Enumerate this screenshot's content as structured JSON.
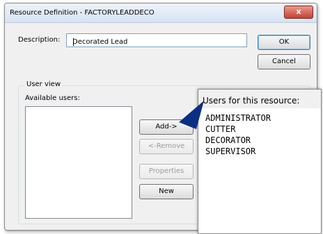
{
  "window": {
    "title": "Resource Definition - FACTORYLEADDECO",
    "close_glyph": "x"
  },
  "description": {
    "label": "Description:",
    "value": "Decorated Lead"
  },
  "buttons": {
    "ok": "OK",
    "cancel": "Cancel",
    "add": "Add->",
    "remove": "<-Remove",
    "properties": "Properties",
    "new": "New"
  },
  "user_view": {
    "group_label": "User view",
    "available_label": "Available users:",
    "available_users": []
  },
  "resource_users": {
    "label": "Users for this resource:",
    "items": [
      "ADMINISTRATOR",
      "CUTTER",
      "DECORATOR",
      "SUPERVISOR"
    ]
  },
  "colors": {
    "callout_arrow": "#0b2f86",
    "titlebar": "#dbe6f4",
    "close": "#c6412f"
  }
}
